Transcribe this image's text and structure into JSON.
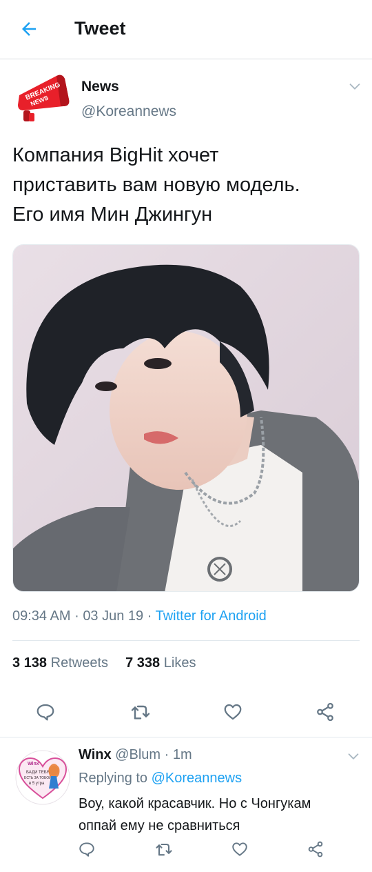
{
  "header": {
    "title": "Tweet",
    "back_icon": "arrow-left-icon"
  },
  "tweet": {
    "author_name": "News",
    "author_handle": "@Koreannews",
    "avatar_text": [
      "BREAKING",
      "NEWS"
    ],
    "text_lines": [
      "Компания BigHit хочет",
      "приставить вам новую модель.",
      "Его имя Мин Джингун"
    ],
    "time": "09:34 AM",
    "separator": "·",
    "date": "03 Jun 19",
    "source": "Twitter for Android",
    "retweets_count": "3 138",
    "retweets_label": "Retweets",
    "likes_count": "7 338",
    "likes_label": "Likes"
  },
  "actions": [
    "reply-icon",
    "retweet-icon",
    "like-icon",
    "share-icon"
  ],
  "reply": {
    "name": "Winx",
    "handle": "@Blum",
    "separator": "·",
    "time": "1m",
    "replying_label": "Replying to",
    "replying_to": "@Koreannews",
    "text_lines": [
      "Воу, какой красавчик. Но с Чонгукам",
      "оппай ему не сравниться"
    ],
    "avatar_text": [
      "Winx",
      "БАДИ ТЕБЯ",
      "ЕСТЬ ЗА ТОБОЙ",
      "в 5 утра"
    ]
  },
  "colors": {
    "accent": "#1da1f2",
    "text": "#14171a",
    "secondary": "#657786",
    "divider": "#e1e8ed",
    "breaking_red": "#e8202a"
  }
}
